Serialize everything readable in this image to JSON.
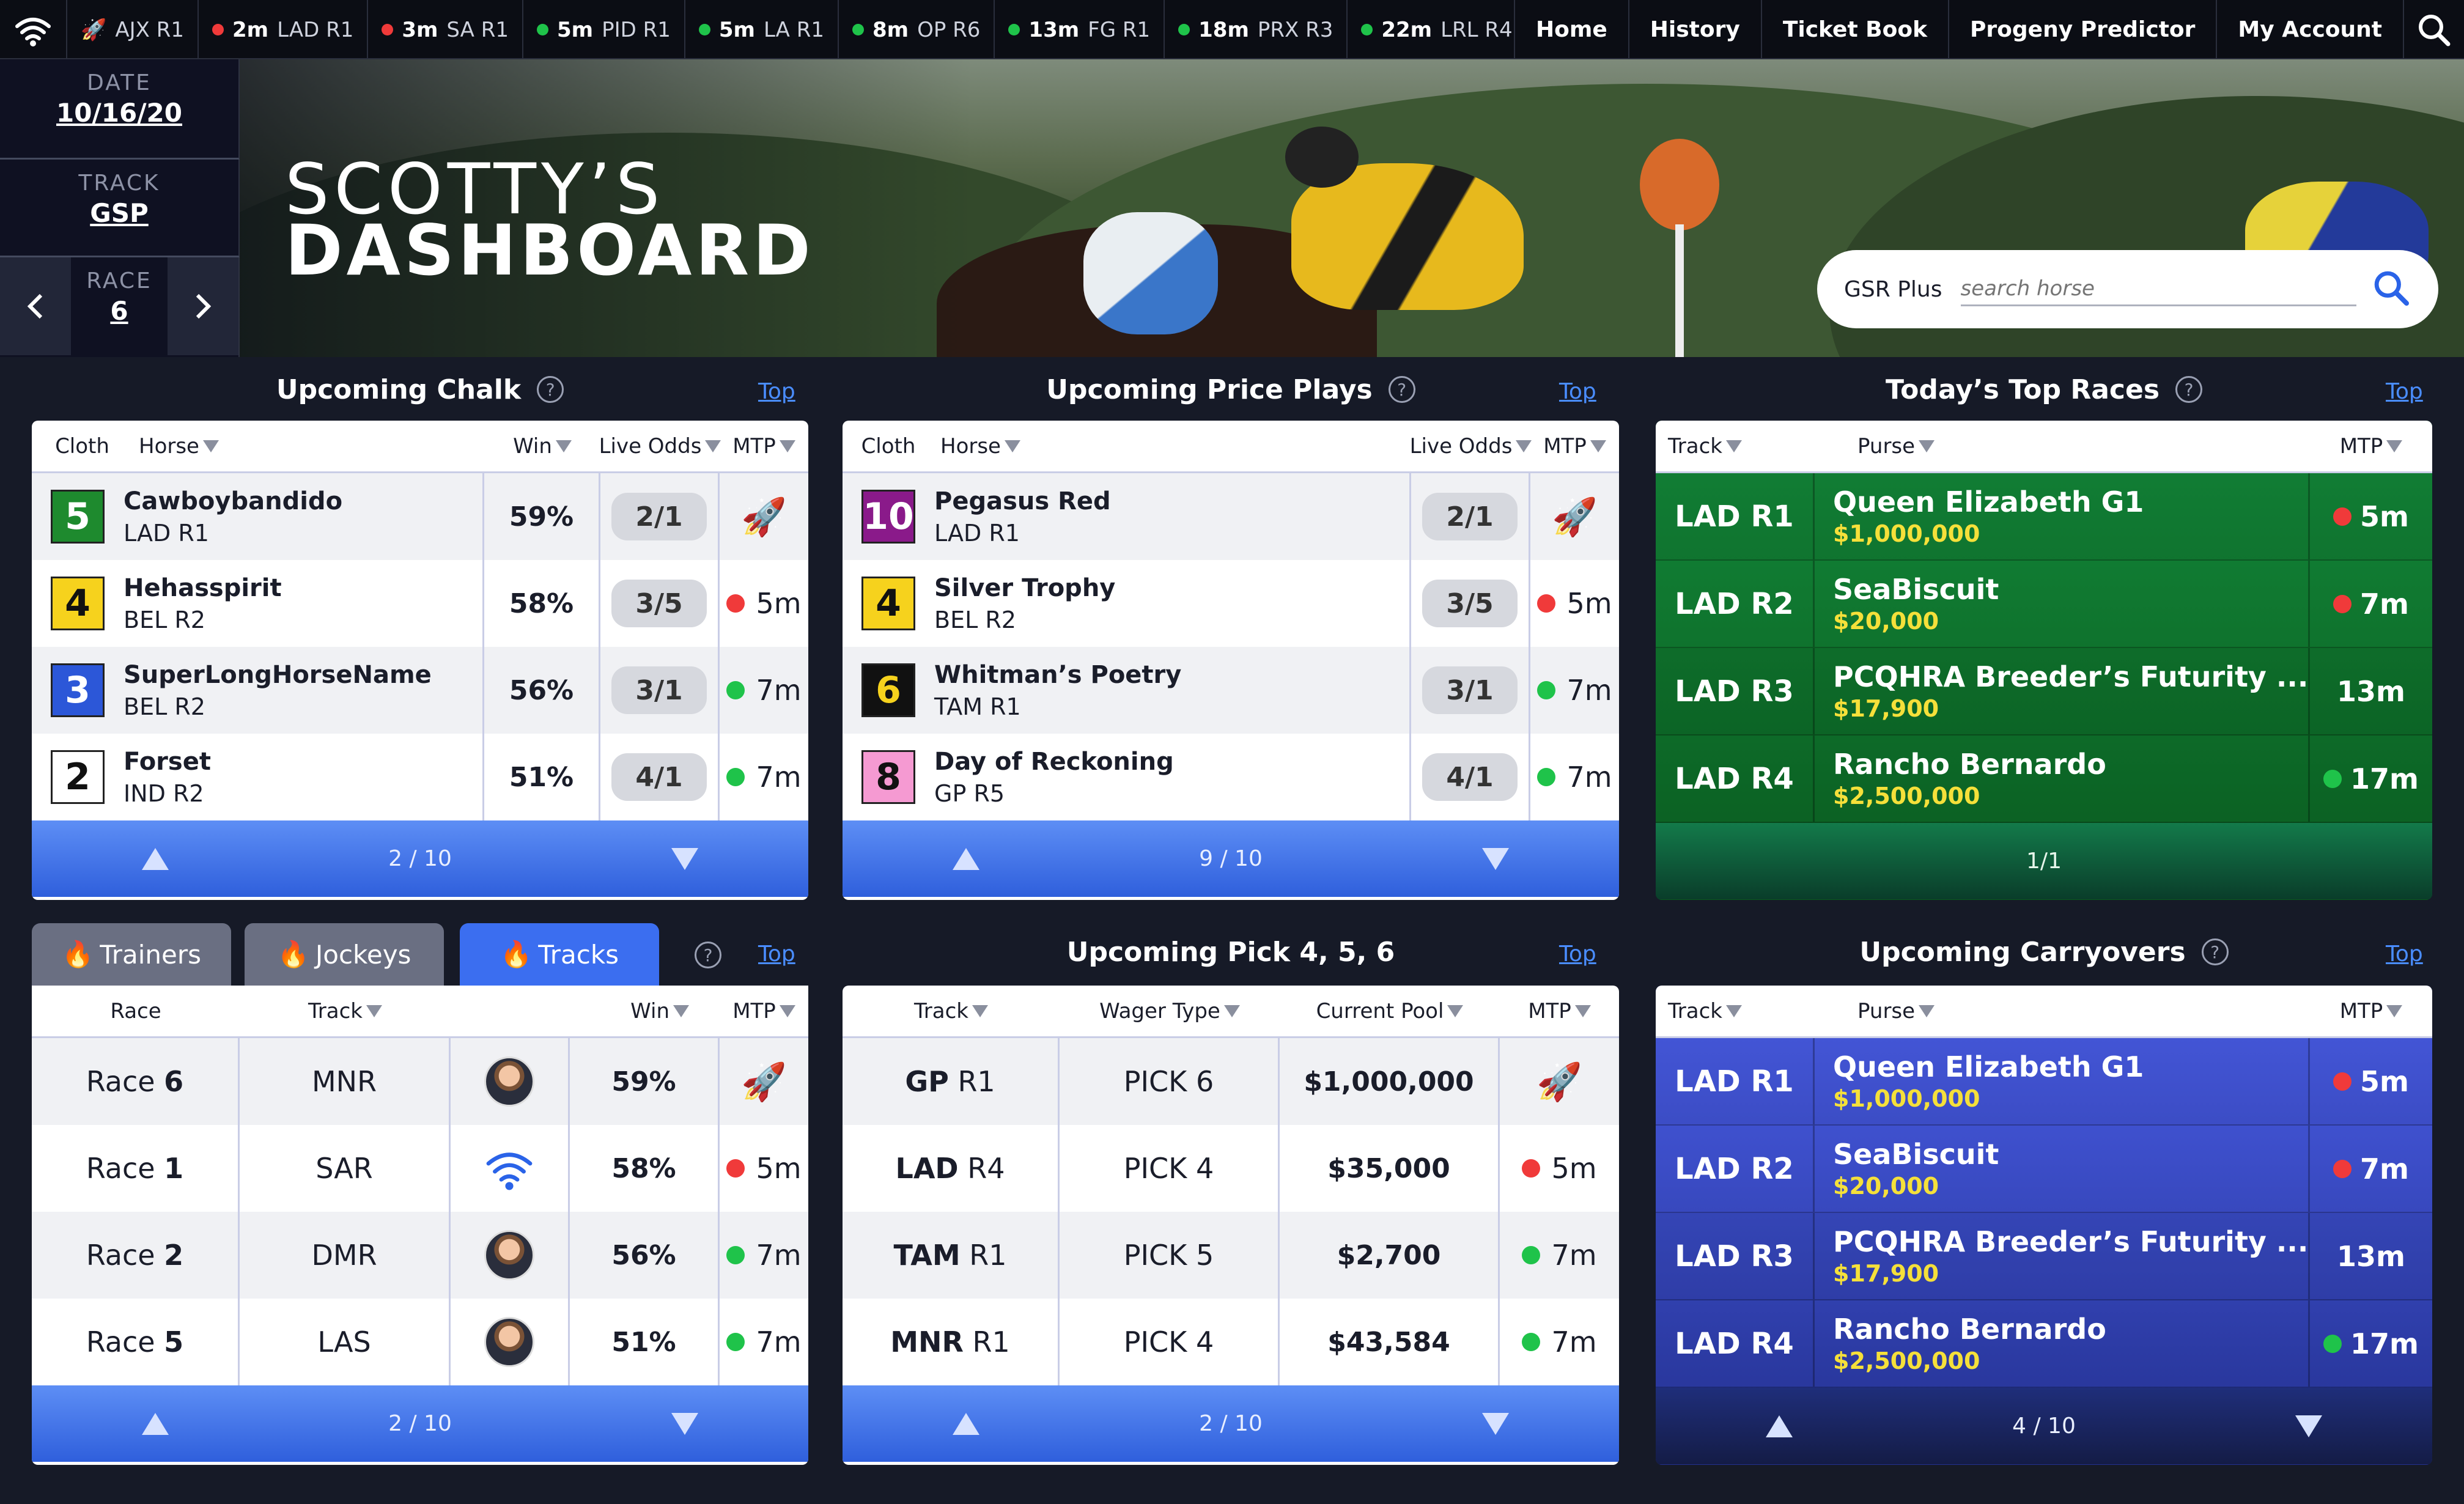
{
  "ticker": [
    {
      "time": "",
      "race": "AJX R1",
      "status": "rocket"
    },
    {
      "time": "2m",
      "race": "LAD R1",
      "status": "red"
    },
    {
      "time": "3m",
      "race": "SA R1",
      "status": "red"
    },
    {
      "time": "5m",
      "race": "PID R1",
      "status": "green"
    },
    {
      "time": "5m",
      "race": "LA R1",
      "status": "green"
    },
    {
      "time": "8m",
      "race": "OP R6",
      "status": "green"
    },
    {
      "time": "13m",
      "race": "FG R1",
      "status": "green"
    },
    {
      "time": "18m",
      "race": "PRX R3",
      "status": "green"
    },
    {
      "time": "22m",
      "race": "LRL R4",
      "status": "green"
    }
  ],
  "nav": {
    "home": "Home",
    "history": "History",
    "ticket_book": "Ticket Book",
    "progeny": "Progeny Predictor",
    "account": "My Account"
  },
  "side": {
    "date_label": "DATE",
    "date_value": "10/16/20",
    "track_label": "TRACK",
    "track_value": "GSP",
    "race_label": "RACE",
    "race_value": "6"
  },
  "hero": {
    "title_line1": "SCOTTY’S",
    "title_line2": "DASHBOARD",
    "search_brand": "GSR Plus",
    "search_placeholder": "search horse"
  },
  "chalk": {
    "title": "Upcoming Chalk",
    "top": "Top",
    "headers": {
      "cloth": "Cloth",
      "horse": "Horse",
      "win": "Win",
      "odds": "Live Odds",
      "mtp": "MTP"
    },
    "rows": [
      {
        "cloth": "5",
        "cloth_bg": "#1e8a2e",
        "cloth_fg": "#ffffff",
        "horse": "Cawboybandido",
        "race": "LAD R1",
        "win": "59%",
        "odds": "2/1",
        "mtp": "",
        "mtp_status": "rocket"
      },
      {
        "cloth": "4",
        "cloth_bg": "#f6d21d",
        "cloth_fg": "#111111",
        "horse": "Hehasspirit",
        "race": "BEL R2",
        "win": "58%",
        "odds": "3/5",
        "mtp": "5m",
        "mtp_status": "red"
      },
      {
        "cloth": "3",
        "cloth_bg": "#2c57d8",
        "cloth_fg": "#ffffff",
        "horse": "SuperLongHorseName",
        "race": "BEL R2",
        "win": "56%",
        "odds": "3/1",
        "mtp": "7m",
        "mtp_status": "green"
      },
      {
        "cloth": "2",
        "cloth_bg": "#ffffff",
        "cloth_fg": "#111111",
        "horse": "Forset",
        "race": "IND R2",
        "win": "51%",
        "odds": "4/1",
        "mtp": "7m",
        "mtp_status": "green"
      }
    ],
    "pager": "2 / 10"
  },
  "price": {
    "title": "Upcoming Price Plays",
    "top": "Top",
    "headers": {
      "cloth": "Cloth",
      "horse": "Horse",
      "odds": "Live Odds",
      "mtp": "MTP"
    },
    "rows": [
      {
        "cloth": "10",
        "cloth_bg": "#8a1a8a",
        "cloth_fg": "#ffffff",
        "horse": "Pegasus Red",
        "race": "LAD R1",
        "odds": "2/1",
        "mtp": "",
        "mtp_status": "rocket"
      },
      {
        "cloth": "4",
        "cloth_bg": "#f6d21d",
        "cloth_fg": "#111111",
        "horse": "Silver Trophy",
        "race": "BEL R2",
        "odds": "3/5",
        "mtp": "5m",
        "mtp_status": "red"
      },
      {
        "cloth": "6",
        "cloth_bg": "#111111",
        "cloth_fg": "#f6d21d",
        "horse": "Whitman’s Poetry",
        "race": "TAM R1",
        "odds": "3/1",
        "mtp": "7m",
        "mtp_status": "green"
      },
      {
        "cloth": "8",
        "cloth_bg": "#f59ad2",
        "cloth_fg": "#111111",
        "horse": "Day of Reckoning",
        "race": "GP R5",
        "odds": "4/1",
        "mtp": "7m",
        "mtp_status": "green"
      }
    ],
    "pager": "9 / 10"
  },
  "top_races": {
    "title": "Today’s Top Races",
    "top": "Top",
    "headers": {
      "track": "Track",
      "purse": "Purse",
      "mtp": "MTP"
    },
    "rows": [
      {
        "track": "LAD R1",
        "name": "Queen Elizabeth G1",
        "purse": "$1,000,000",
        "mtp": "5m",
        "mtp_status": "red"
      },
      {
        "track": "LAD R2",
        "name": "SeaBiscuit",
        "purse": "$20,000",
        "mtp": "7m",
        "mtp_status": "red"
      },
      {
        "track": "LAD R3",
        "name": "PCQHRA Breeder’s Futurity ...",
        "purse": "$17,900",
        "mtp": "13m",
        "mtp_status": "none"
      },
      {
        "track": "LAD R4",
        "name": "Rancho Bernardo",
        "purse": "$2,500,000",
        "mtp": "17m",
        "mtp_status": "green"
      }
    ],
    "pager": "1/1"
  },
  "tabs": {
    "trainers": "Trainers",
    "jockeys": "Jockeys",
    "tracks": "Tracks",
    "top": "Top"
  },
  "tracks": {
    "headers": {
      "race": "Race",
      "track": "Track",
      "win": "Win",
      "mtp": "MTP"
    },
    "race_word": "Race",
    "rows": [
      {
        "race": "6",
        "track": "MNR",
        "icon": "avatar",
        "win": "59%",
        "mtp": "",
        "mtp_status": "rocket"
      },
      {
        "race": "1",
        "track": "SAR",
        "icon": "wifi-logo",
        "win": "58%",
        "mtp": "5m",
        "mtp_status": "red"
      },
      {
        "race": "2",
        "track": "DMR",
        "icon": "avatar",
        "win": "56%",
        "mtp": "7m",
        "mtp_status": "green"
      },
      {
        "race": "5",
        "track": "LAS",
        "icon": "avatar",
        "win": "51%",
        "mtp": "7m",
        "mtp_status": "green"
      }
    ],
    "pager": "2 / 10"
  },
  "pick": {
    "title": "Upcoming Pick 4, 5, 6",
    "top": "Top",
    "headers": {
      "track": "Track",
      "wager": "Wager Type",
      "pool": "Current Pool",
      "mtp": "MTP"
    },
    "rows": [
      {
        "track_code": "GP",
        "track_race": "R1",
        "wager": "PICK 6",
        "pool": "$1,000,000",
        "mtp": "",
        "mtp_status": "rocket"
      },
      {
        "track_code": "LAD",
        "track_race": "R4",
        "wager": "PICK 4",
        "pool": "$35,000",
        "mtp": "5m",
        "mtp_status": "red"
      },
      {
        "track_code": "TAM",
        "track_race": "R1",
        "wager": "PICK 5",
        "pool": "$2,700",
        "mtp": "7m",
        "mtp_status": "green"
      },
      {
        "track_code": "MNR",
        "track_race": "R1",
        "wager": "PICK 4",
        "pool": "$43,584",
        "mtp": "7m",
        "mtp_status": "green"
      }
    ],
    "pager": "2 / 10"
  },
  "carryovers": {
    "title": "Upcoming Carryovers",
    "top": "Top",
    "headers": {
      "track": "Track",
      "purse": "Purse",
      "mtp": "MTP"
    },
    "rows": [
      {
        "track": "LAD R1",
        "name": "Queen Elizabeth G1",
        "purse": "$1,000,000",
        "mtp": "5m",
        "mtp_status": "red"
      },
      {
        "track": "LAD R2",
        "name": "SeaBiscuit",
        "purse": "$20,000",
        "mtp": "7m",
        "mtp_status": "red"
      },
      {
        "track": "LAD R3",
        "name": "PCQHRA Breeder’s Futurity ...",
        "purse": "$17,900",
        "mtp": "13m",
        "mtp_status": "none"
      },
      {
        "track": "LAD R4",
        "name": "Rancho Bernardo",
        "purse": "$2,500,000",
        "mtp": "17m",
        "mtp_status": "green"
      }
    ],
    "pager": "4 / 10"
  },
  "colors": {
    "top_races_green": "#0f7a2c",
    "carryover_blue": "#3a4ed0",
    "pager_blue": "#3a6ae6",
    "link_blue": "#4a8dff",
    "red": "#f03a3a",
    "green": "#1fc34a"
  },
  "icons": {
    "logo": "wifi-logo-icon",
    "search": "search-icon",
    "help": "help-icon",
    "rocket": "rocket-icon",
    "fire": "fire-icon",
    "left": "chevron-left-icon",
    "right": "chevron-right-icon"
  }
}
